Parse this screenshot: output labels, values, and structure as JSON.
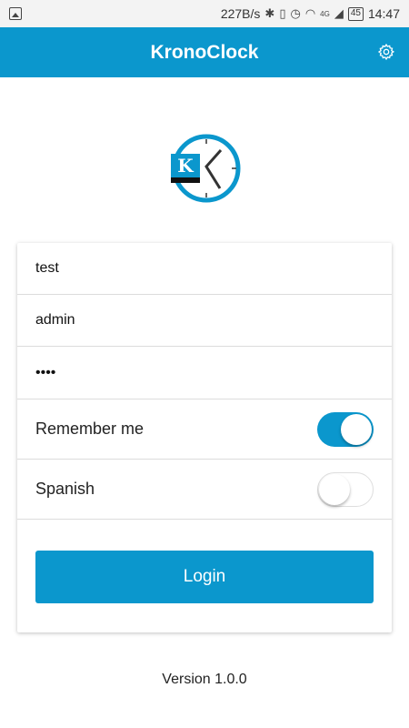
{
  "status_bar": {
    "network_speed": "227B/s",
    "network_type": "4G",
    "battery": "45",
    "time": "14:47"
  },
  "header": {
    "title": "KronoClock",
    "settings_icon": "gear-icon"
  },
  "logo": {
    "letter": "K"
  },
  "form": {
    "server_value": "test",
    "username_value": "admin",
    "password_value": "1234",
    "remember_label": "Remember me",
    "remember_on": true,
    "spanish_label": "Spanish",
    "spanish_on": false,
    "login_label": "Login"
  },
  "footer": {
    "version": "Version 1.0.0"
  },
  "colors": {
    "accent": "#0b97cd"
  }
}
